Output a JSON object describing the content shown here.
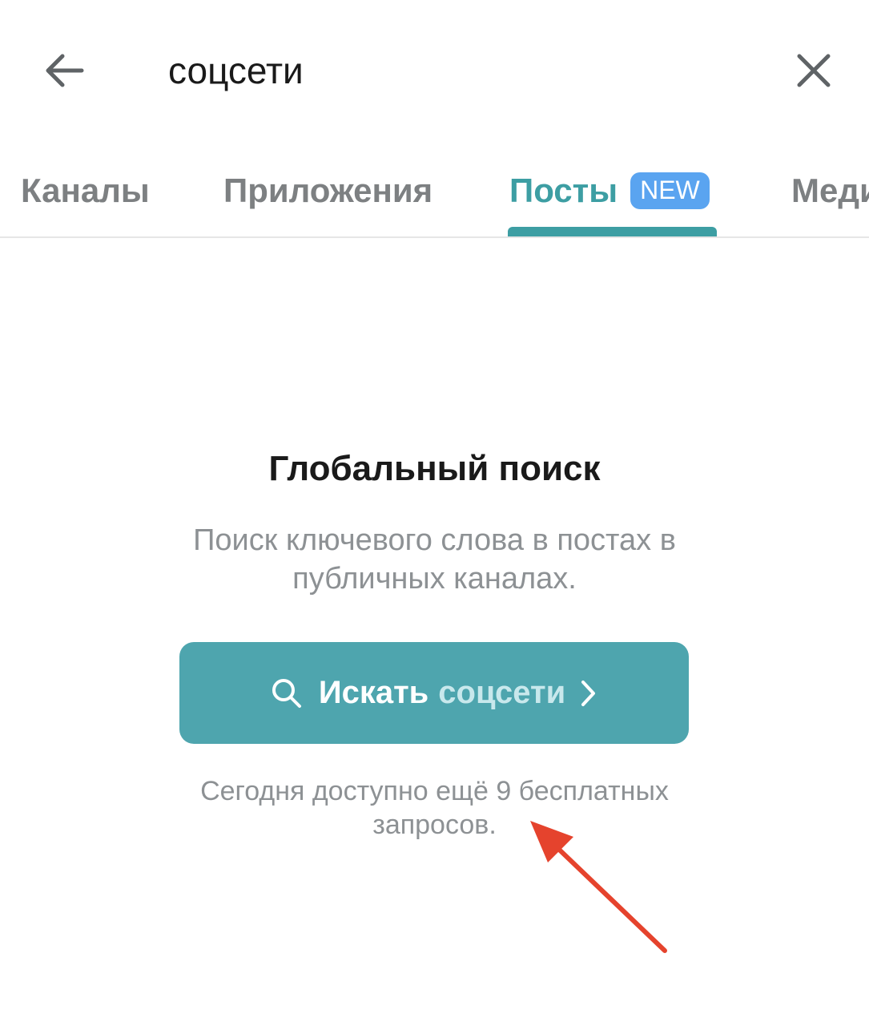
{
  "search": {
    "value": "соцсети",
    "placeholder": ""
  },
  "icons": {
    "back": "arrow-left-icon",
    "close": "close-icon",
    "search": "search-icon",
    "chevron": "chevron-right-icon"
  },
  "tabs": [
    {
      "label": "Каналы",
      "active": false
    },
    {
      "label": "Приложения",
      "active": false
    },
    {
      "label": "Посты",
      "active": true,
      "badge": "NEW"
    },
    {
      "label": "Медиа",
      "active": false
    }
  ],
  "main": {
    "title": "Глобальный поиск",
    "description": "Поиск ключевого слова в постах в публичных каналах.",
    "button_label": "Искать",
    "button_query": "соцсети",
    "quota_text": "Сегодня доступно ещё 9 бесплатных запросов."
  },
  "colors": {
    "accent": "#3d9ea3",
    "button_bg": "#4ea5ae",
    "badge_bg": "#5aa4f0",
    "annotation_arrow": "#e5432d"
  }
}
